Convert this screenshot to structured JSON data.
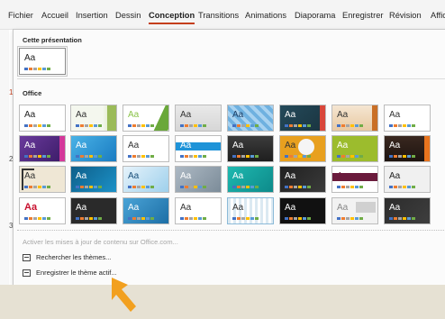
{
  "ribbon": {
    "tabs": [
      {
        "label": "Fichier",
        "active": false
      },
      {
        "label": "Accueil",
        "active": false
      },
      {
        "label": "Insertion",
        "active": false
      },
      {
        "label": "Dessin",
        "active": false
      },
      {
        "label": "Conception",
        "active": true
      },
      {
        "label": "Transitions",
        "active": false
      },
      {
        "label": "Animations",
        "active": false
      },
      {
        "label": "Diaporama",
        "active": false
      },
      {
        "label": "Enregistrer",
        "active": false
      },
      {
        "label": "Révision",
        "active": false
      },
      {
        "label": "Affic",
        "active": false
      }
    ]
  },
  "slide_numbers": [
    "1",
    "2",
    "3"
  ],
  "themes_panel": {
    "current_section_label": "Cette présentation",
    "office_section_label": "Office",
    "thumb_text": "Aa",
    "menu": {
      "update_label": "Activer les mises à jour de contenu sur Office.com...",
      "browse_label": "Rechercher les thèmes...",
      "save_label": "Enregistrer le thème actif..."
    }
  },
  "colors": {
    "accent_tab_underline": "#c43e1c",
    "pointer_arrow": "#f2a01f",
    "swatch_palette": [
      "#4472c4",
      "#ed7d31",
      "#a5a5a5",
      "#ffc000",
      "#5b9bd5",
      "#70ad47"
    ]
  }
}
